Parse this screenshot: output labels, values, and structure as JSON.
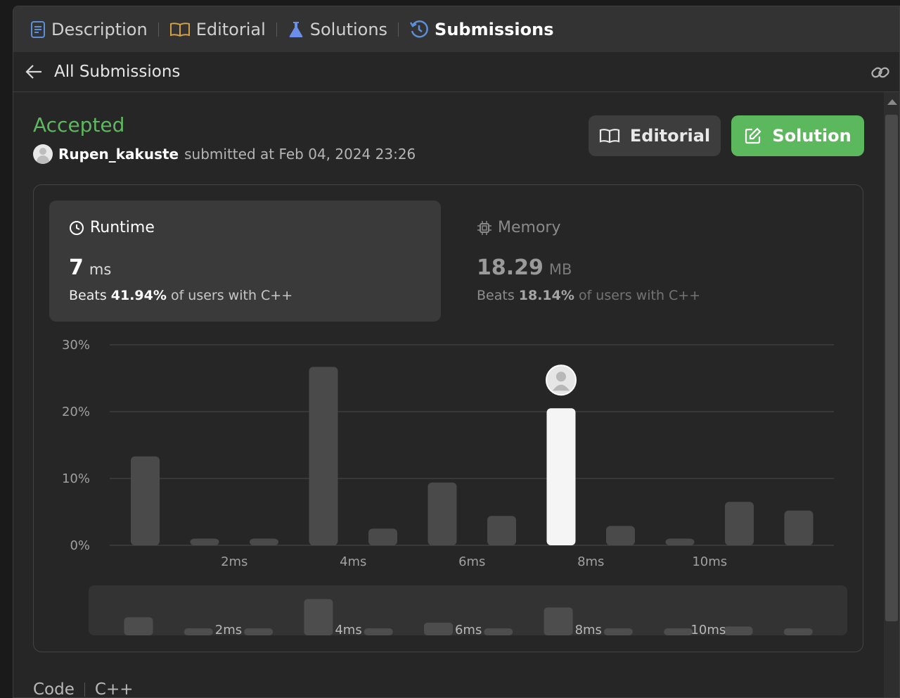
{
  "tabs": [
    {
      "label": "Description",
      "icon": "description-icon"
    },
    {
      "label": "Editorial",
      "icon": "book-icon"
    },
    {
      "label": "Solutions",
      "icon": "flask-icon"
    },
    {
      "label": "Submissions",
      "icon": "history-icon",
      "active": true
    }
  ],
  "subheader": {
    "back_label": "All Submissions"
  },
  "submission": {
    "status": "Accepted",
    "username": "Rupen_kakuste",
    "submitted_text": "submitted at Feb 04, 2024 23:26"
  },
  "buttons": {
    "editorial": "Editorial",
    "solution": "Solution"
  },
  "runtime": {
    "title": "Runtime",
    "value": "7",
    "unit": "ms",
    "beats_prefix": "Beats",
    "beats_pct": "41.94%",
    "beats_suffix": "of users with C++"
  },
  "memory": {
    "title": "Memory",
    "value": "18.29",
    "unit": "MB",
    "beats_prefix": "Beats",
    "beats_pct": "18.14%",
    "beats_suffix": "of users with C++"
  },
  "chart_data": {
    "type": "bar",
    "y_ticks": [
      "30%",
      "20%",
      "10%",
      "0%"
    ],
    "ylim": [
      0,
      30
    ],
    "x_tick_labels": [
      "2ms",
      "4ms",
      "6ms",
      "8ms",
      "10ms"
    ],
    "values": [
      13.3,
      1.0,
      1.0,
      26.7,
      2.5,
      9.4,
      4.4,
      20.5,
      2.9,
      1.0,
      6.5,
      5.2
    ],
    "highlight_index": 7,
    "grid": true
  },
  "code_section": {
    "label": "Code",
    "language": "C++"
  },
  "colors": {
    "accent_green": "#5cb85c",
    "status_green": "#5fb85f",
    "bar": "#4a4a4a",
    "bar_highlight": "#f5f5f5"
  }
}
